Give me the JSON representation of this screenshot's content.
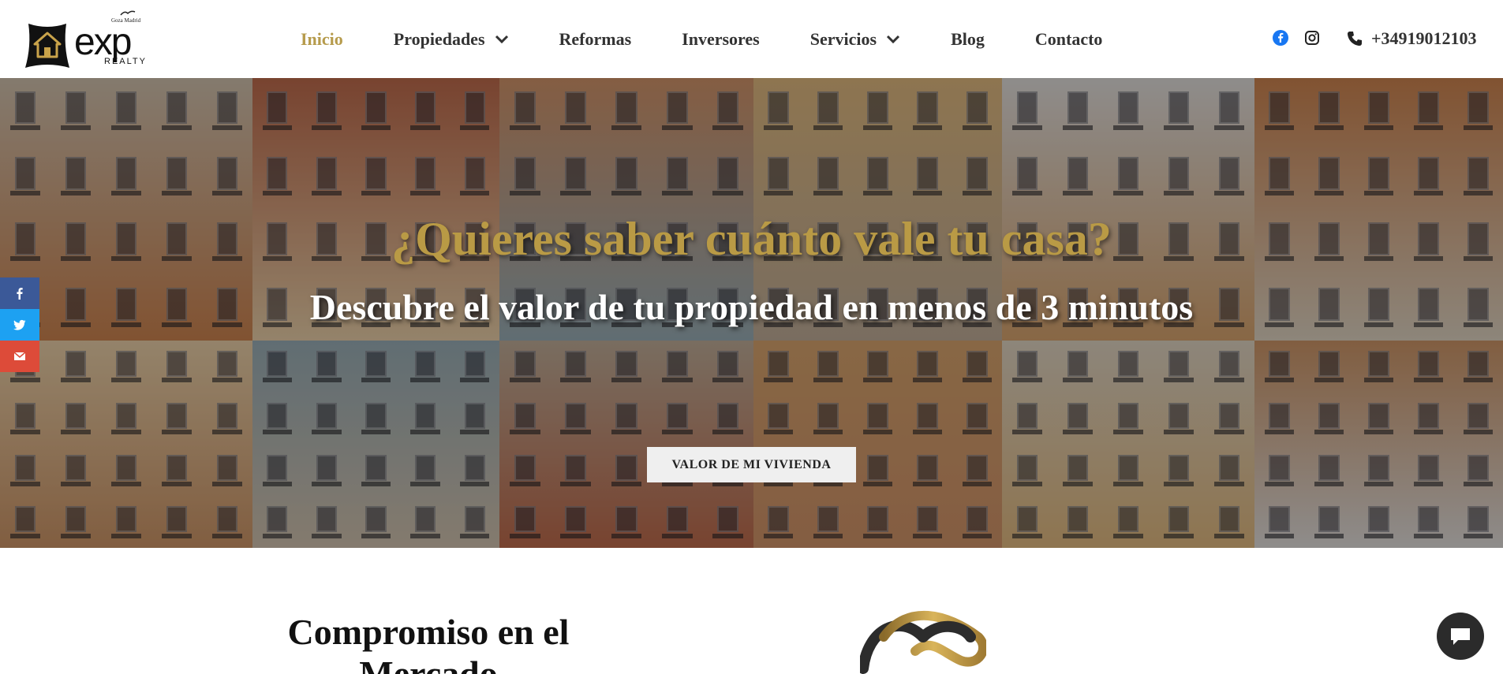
{
  "logo": {
    "tagline": "Goza Madrid",
    "wordmark": "exp",
    "subword": "REALTY"
  },
  "nav": {
    "items": [
      {
        "label": "Inicio",
        "active": true,
        "dropdown": false
      },
      {
        "label": "Propiedades",
        "active": false,
        "dropdown": true
      },
      {
        "label": "Reformas",
        "active": false,
        "dropdown": false
      },
      {
        "label": "Inversores",
        "active": false,
        "dropdown": false
      },
      {
        "label": "Servicios",
        "active": false,
        "dropdown": true
      },
      {
        "label": "Blog",
        "active": false,
        "dropdown": false
      },
      {
        "label": "Contacto",
        "active": false,
        "dropdown": false
      }
    ]
  },
  "header_social": [
    "facebook-icon",
    "instagram-icon"
  ],
  "phone": {
    "icon": "phone-icon",
    "number": "+34919012103"
  },
  "hero": {
    "title": "¿Quieres saber cuánto vale tu casa?",
    "subtitle": "Descubre el valor de tu propiedad en menos de 3 minutos",
    "cta_label": "VALOR DE MI VIVIENDA"
  },
  "share_bar": [
    {
      "icon": "facebook-icon",
      "color": "#3b5998"
    },
    {
      "icon": "twitter-icon",
      "color": "#1da1f2"
    },
    {
      "icon": "email-icon",
      "color": "#dd4b39"
    }
  ],
  "section": {
    "title": "Compromiso en el Mercado"
  },
  "colors": {
    "accent_gold": "#b69b4c",
    "hero_title": "#b99a45",
    "facebook": "#1877f2"
  }
}
